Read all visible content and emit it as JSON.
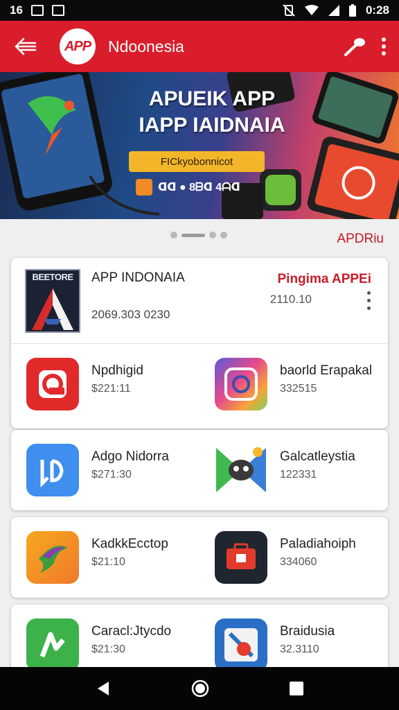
{
  "status_bar": {
    "left_text": "16",
    "time": "0:28"
  },
  "app_bar": {
    "logo_text": "APP",
    "title": "Ndoonesia"
  },
  "hero": {
    "title": "APUEIK APP IAPP IAIDNAIA",
    "button_label": "FICkyobonnicot",
    "meta_text": "ᗡᗡ ● 8ᗷᗡ 4ᗩᗡ"
  },
  "section_link": "APDRiu",
  "featured": {
    "icon_brand": "BEETORE",
    "name": "APP INDONAIA",
    "subtitle": "2069.303 0230",
    "badge": "Pingima APPEi",
    "count": "2110.10"
  },
  "apps": [
    {
      "name": "Npdhigid",
      "price": "$221:11"
    },
    {
      "name": "baorld Erapakal",
      "price": "332515"
    },
    {
      "name": "Adgo Nidorra",
      "price": "$271:30"
    },
    {
      "name": "Galcatleystia",
      "price": "122331"
    },
    {
      "name": "KadkkEcctop",
      "price": "$21:10"
    },
    {
      "name": "Paladiahoiph",
      "price": "334060"
    },
    {
      "name": "Caracl:Jtycdo",
      "price": "$21:30"
    },
    {
      "name": "Braidusia",
      "price": "32.3110"
    }
  ],
  "colors": {
    "brand_red": "#d91d2a",
    "accent_yellow": "#f3b62a"
  },
  "icons": [
    "back-arrow-icon",
    "microphone-icon",
    "more-vert-icon",
    "nav-back-icon",
    "nav-home-icon",
    "nav-recents-icon"
  ]
}
